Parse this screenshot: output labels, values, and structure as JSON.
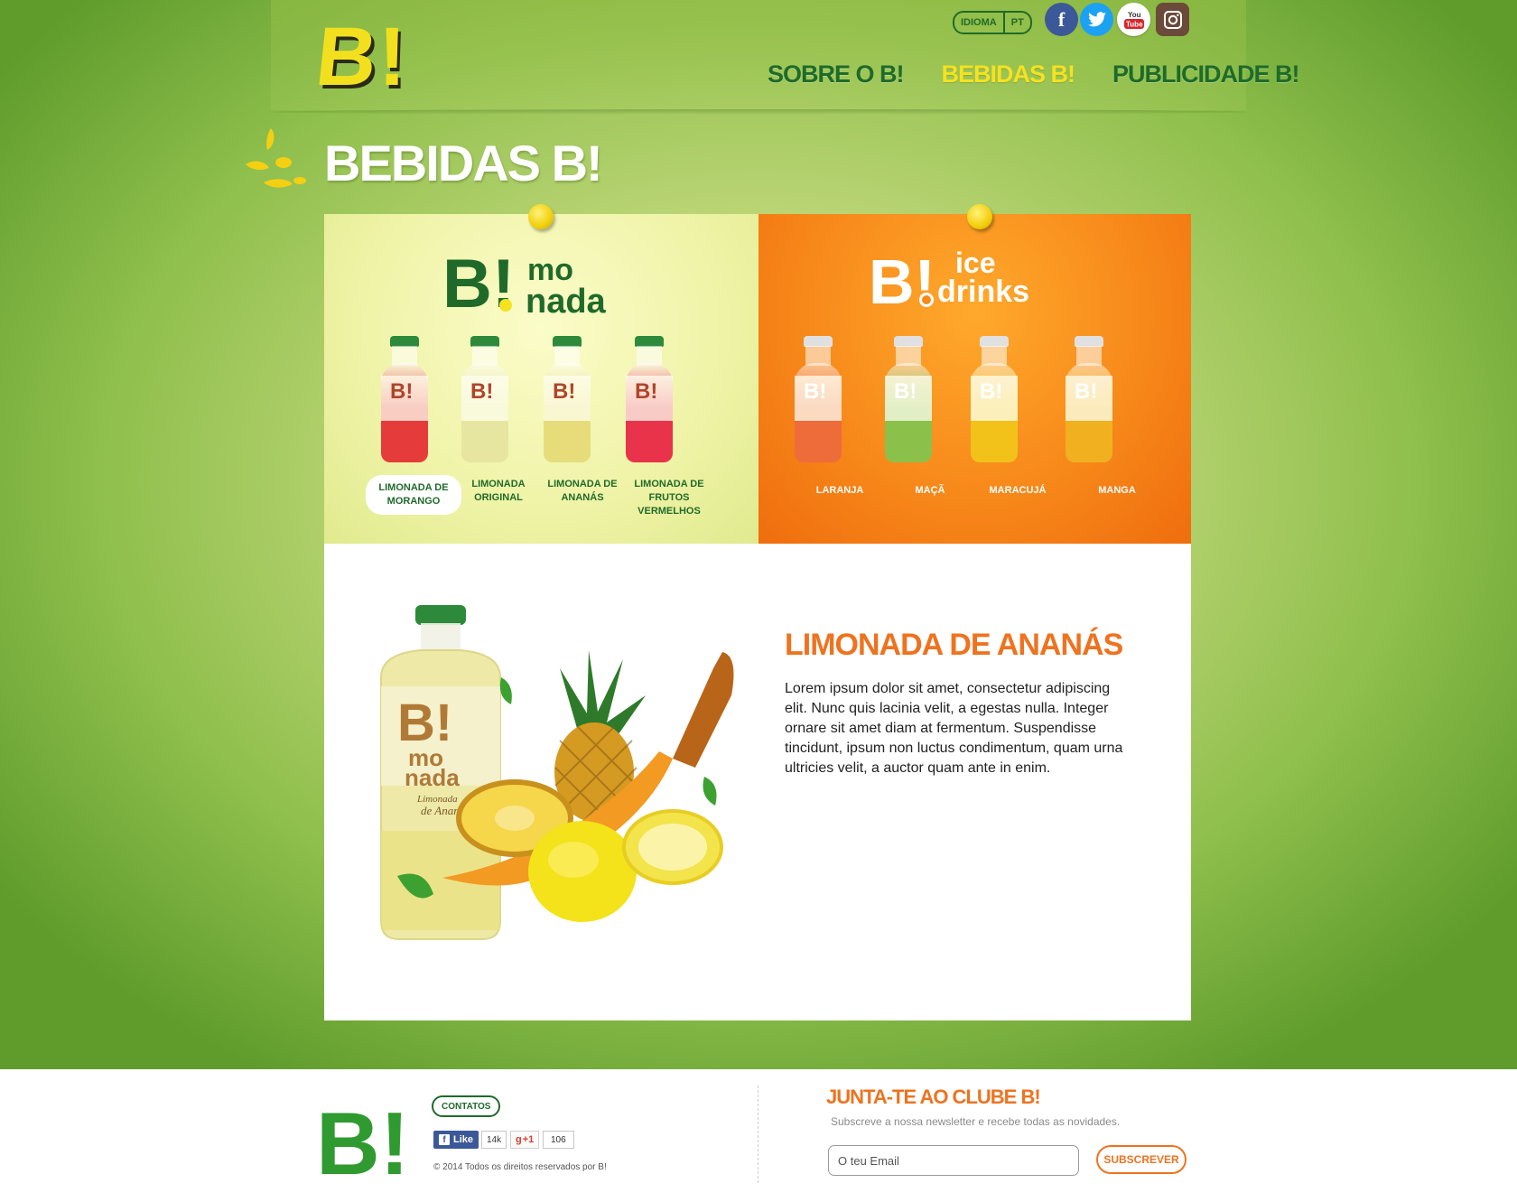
{
  "header": {
    "language": {
      "label": "IDIOMA",
      "value": "PT"
    },
    "social": [
      {
        "name": "facebook",
        "glyph": "f",
        "color": "#3b5998"
      },
      {
        "name": "twitter",
        "glyph": "t",
        "color": "#1da1f2"
      },
      {
        "name": "youtube",
        "glyph": "You Tube",
        "color": "#ffffff"
      },
      {
        "name": "instagram",
        "glyph": "◎",
        "color": "#6b4a3a"
      }
    ],
    "nav": [
      {
        "label": "SOBRE O B!",
        "active": false
      },
      {
        "label": "BEBIDAS B!",
        "active": true
      },
      {
        "label": "PUBLICIDADE B!",
        "active": false
      }
    ]
  },
  "page_title": "BEBIDAS B!",
  "limonada": {
    "brand": {
      "b": "B!",
      "line1": "mo",
      "line2": "nada"
    },
    "products": [
      {
        "label": "LIMONADA DE MORANGO",
        "color": "#e63b3b",
        "selected": true
      },
      {
        "label": "LIMONADA ORIGINAL",
        "color": "#e6e6a0",
        "selected": false
      },
      {
        "label": "LIMONADA DE ANANÁS",
        "color": "#e6dd7a",
        "selected": false
      },
      {
        "label": "LIMONADA DE FRUTOS VERMELHOS",
        "color": "#e8334a",
        "selected": false
      }
    ]
  },
  "icedrinks": {
    "brand": {
      "b": "B!",
      "line1": "ice",
      "line2": "drinks"
    },
    "products": [
      {
        "label": "LARANJA",
        "color": "#ee6b3a"
      },
      {
        "label": "MAÇÃ",
        "color": "#8bc04a"
      },
      {
        "label": "MARACUJÁ",
        "color": "#f2c21a"
      },
      {
        "label": "MANGA",
        "color": "#f0b020"
      }
    ]
  },
  "detail": {
    "title": "LIMONADA DE ANANÁS",
    "text": "Lorem ipsum dolor sit amet, consectetur adipiscing elit. Nunc quis lacinia velit, a egestas nulla. Integer ornare sit amet diam at fermentum. Suspendisse tincidunt, ipsum non luctus condimentum, quam urna ultricies velit, a auctor quam ante in enim.",
    "bottle_brand": {
      "b": "B!",
      "line1": "mo",
      "line2": "nada",
      "sub1": "Limonada",
      "sub2": "de Ananás"
    }
  },
  "footer": {
    "contacts": "CONTATOS",
    "fb_like": "Like",
    "fb_count": "14k",
    "gplus": "+1",
    "gplus_count": "106",
    "copyright": "© 2014 Todos os direitos reservados por B!",
    "club_title": "JUNTA-TE AO CLUBE B!",
    "club_sub": "Subscreve a nossa newsletter e recebe todas as novidades.",
    "email_placeholder": "O teu Email",
    "subscribe": "SUBSCREVER"
  },
  "logo": {
    "text": "B!"
  }
}
